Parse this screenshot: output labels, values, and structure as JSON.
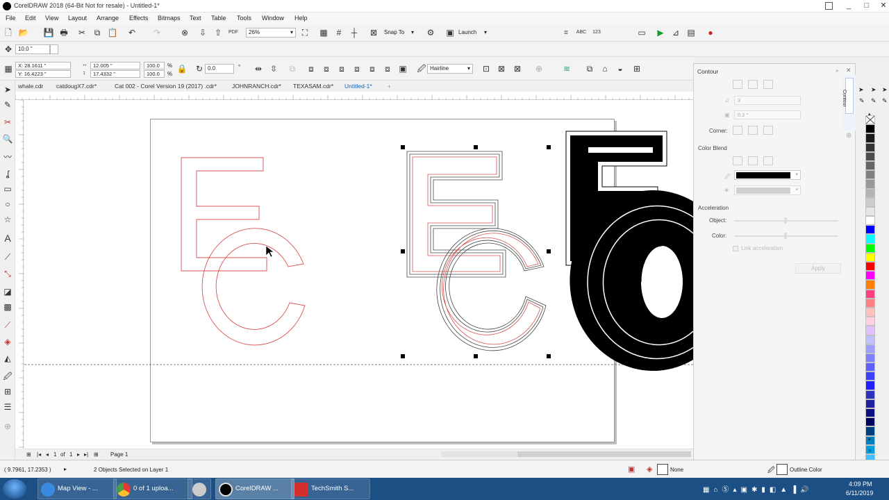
{
  "app": {
    "title": "CorelDRAW 2018 (64-Bit Not for resale) - Untitled-1*",
    "window_controls": [
      "_",
      "□",
      "✕"
    ]
  },
  "menu": [
    "File",
    "Edit",
    "View",
    "Layout",
    "Arrange",
    "Effects",
    "Bitmaps",
    "Text",
    "Table",
    "Tools",
    "Window",
    "Help"
  ],
  "toolbar": {
    "zoom": "26%",
    "snap_to": "Snap To",
    "launch": "Launch"
  },
  "property_bar": {
    "nudge": "10.0 \"",
    "x": "X: 28.1611 \"",
    "y": "Y: 16.4223 \"",
    "width": "12.005 \"",
    "height": "17.4332 \"",
    "scale_w": "100.0",
    "scale_h": "100.0",
    "pct1": "%",
    "pct2": "%",
    "rotation": "0.0",
    "rotation_unit": "°",
    "outline": "Hairline"
  },
  "doc_tabs": [
    "whale.cdr",
    "catdougX7.cdr*",
    "Cat 002 - Corel Version 19 (2017) .cdr*",
    "JOHNRANCH.cdr*",
    "TEXASAM.cdr*",
    "Untitled-1*"
  ],
  "page_nav": {
    "current": "1",
    "of": "of",
    "total": "1",
    "page_tab": "Page 1"
  },
  "status": {
    "coords": "( 9.7961, 17.2353 )",
    "selection": "2 Objects Selected on Layer 1",
    "fill": "None",
    "outline": "Outline Color"
  },
  "docker": {
    "title": "Contour",
    "side_tab": "Contour",
    "steps": "3",
    "offset": "0.2 \"",
    "corner_label": "Corner:",
    "color_blend_label": "Color Blend",
    "acceleration_label": "Acceleration",
    "object_label": "Object:",
    "color_label": "Color:",
    "link_acceleration": "Link acceleration",
    "apply": "Apply",
    "outline_color": "#000000",
    "fill_color": "#c8c8c8"
  },
  "palette_colors": [
    "#ffffff",
    "#000000",
    "#1a1a1a",
    "#333333",
    "#4d4d4d",
    "#666666",
    "#808080",
    "#999999",
    "#b3b3b3",
    "#cccccc",
    "#e6e6e6",
    "#ffffff",
    "#0000ff",
    "#00ffff",
    "#00ff00",
    "#ffff00",
    "#ff0000",
    "#ff00ff",
    "#ff8000",
    "#ff4080",
    "#ff8080",
    "#ffc0c0",
    "#ffd0e0",
    "#e0c0ff",
    "#c0c0ff",
    "#a0a0ff",
    "#8080ff",
    "#6060ff",
    "#4040ff",
    "#2020ff",
    "#3030c0",
    "#2020a0",
    "#101080",
    "#000060",
    "#004080",
    "#0080c0",
    "#00a0e0",
    "#40c0ff",
    "#80d0ff"
  ],
  "taskbar": {
    "buttons": [
      "Map View - ...",
      "0 of 1 uploa...",
      "",
      "CorelDRAW ...",
      "TechSmith S..."
    ],
    "time": "4:09 PM",
    "date": "6/11/2019"
  }
}
